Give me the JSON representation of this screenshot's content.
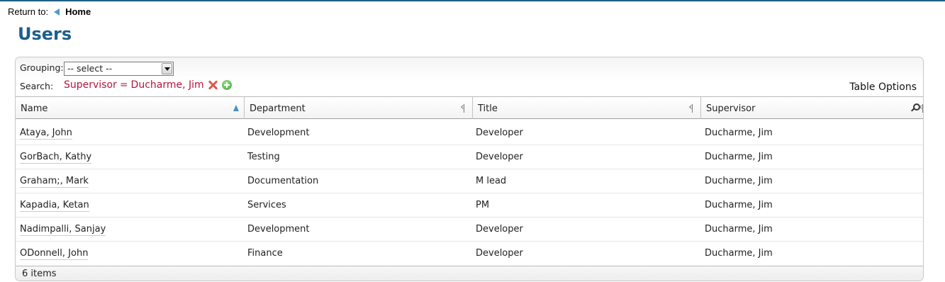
{
  "nav": {
    "return_label": "Return to:",
    "home_label": "Home"
  },
  "page": {
    "title": "Users"
  },
  "toolbar": {
    "grouping_label": "Grouping:",
    "grouping_value": "-- select --",
    "search_label": "Search:",
    "filter_field": "Supervisor",
    "filter_operator": "=",
    "filter_value": "Ducharme, Jim",
    "table_options_label": "Table Options"
  },
  "columns": [
    "Name",
    "Department",
    "Title",
    "Supervisor"
  ],
  "rows": [
    {
      "name": "Ataya, John",
      "department": "Development",
      "title": "Developer",
      "supervisor": "Ducharme, Jim"
    },
    {
      "name": "GorBach, Kathy",
      "department": "Testing",
      "title": "Developer",
      "supervisor": "Ducharme, Jim"
    },
    {
      "name": "Graham;, Mark",
      "department": "Documentation",
      "title": "M lead",
      "supervisor": "Ducharme, Jim"
    },
    {
      "name": "Kapadia, Ketan",
      "department": "Services",
      "title": "PM",
      "supervisor": "Ducharme, Jim"
    },
    {
      "name": "Nadimpalli, Sanjay",
      "department": "Development",
      "title": "Developer",
      "supervisor": "Ducharme, Jim"
    },
    {
      "name": "ODonnell, John",
      "department": "Finance",
      "title": "Developer",
      "supervisor": "Ducharme, Jim"
    }
  ],
  "footer": {
    "count_label": "6 items"
  },
  "colors": {
    "title": "#1d5e8c",
    "filter_text": "#b5143c",
    "top_border": "#1f5f86"
  }
}
